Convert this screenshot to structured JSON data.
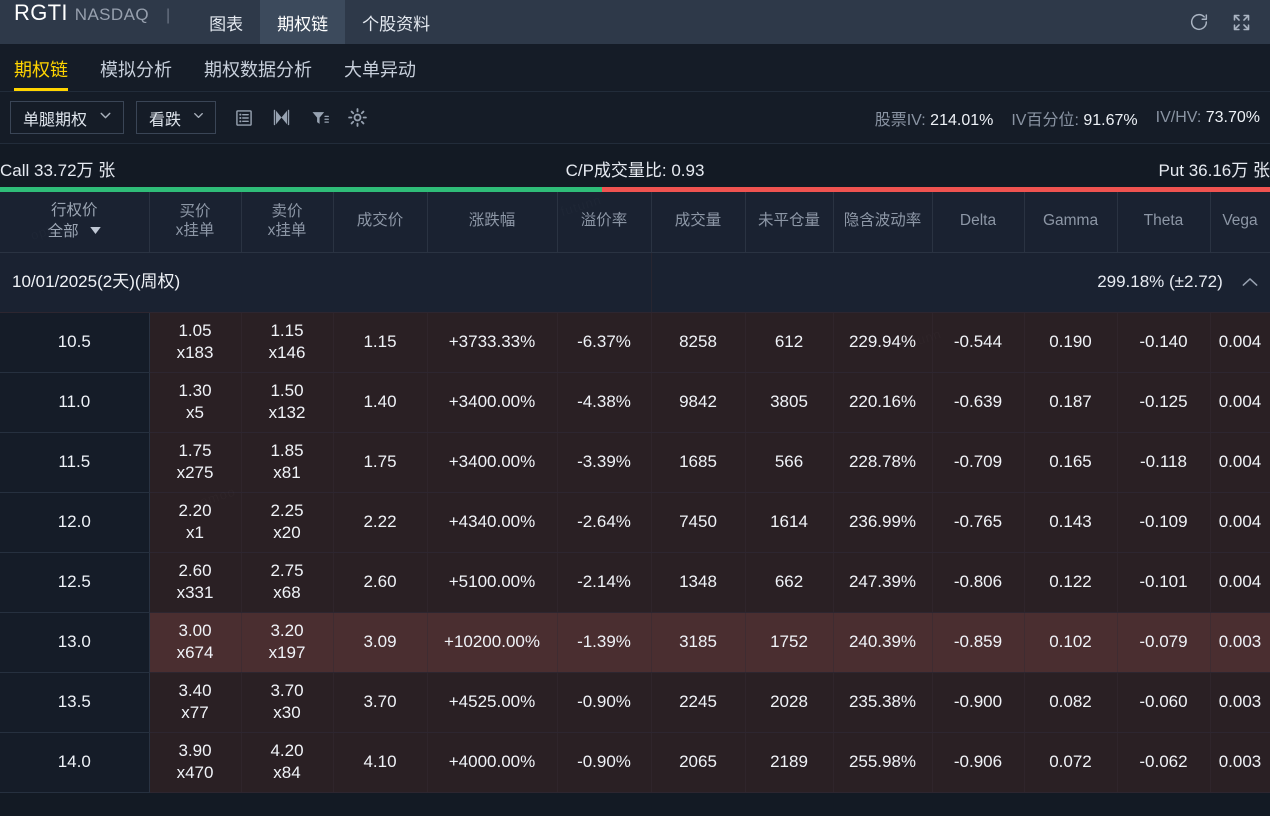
{
  "topbar": {
    "symbol": "RGTI",
    "exchange": "NASDAQ",
    "divider": "|",
    "nav": [
      {
        "label": "图表",
        "active": false
      },
      {
        "label": "期权链",
        "active": true
      },
      {
        "label": "个股资料",
        "active": false
      }
    ],
    "refresh_icon": "refresh-icon",
    "fullscreen_icon": "fullscreen-icon"
  },
  "subnav": [
    {
      "label": "期权链",
      "active": true
    },
    {
      "label": "模拟分析",
      "active": false
    },
    {
      "label": "期权数据分析",
      "active": false
    },
    {
      "label": "大单异动",
      "active": false
    }
  ],
  "toolbar": {
    "strategy_select": "单腿期权",
    "direction_select": "看跌",
    "icons": [
      "list-icon",
      "mirror-icon",
      "filter-icon",
      "gear-icon"
    ],
    "stats": [
      {
        "label": "股票IV:",
        "value": "214.01%"
      },
      {
        "label": "IV百分位:",
        "value": "91.67%"
      },
      {
        "label": "IV/HV:",
        "value": "73.70%"
      }
    ]
  },
  "volume_bar": {
    "call_label": "Call 33.72万 张",
    "ratio_label": "C/P成交量比: 0.93",
    "put_label": "Put 36.16万 张",
    "call_pct": 47.4,
    "call_color": "#2fbd78",
    "put_color": "#ef5350"
  },
  "table": {
    "columns": [
      {
        "key": "strike",
        "line1": "行权价",
        "line2": "全部",
        "has_filter": true
      },
      {
        "key": "bid",
        "line1": "买价",
        "line2": "x挂单"
      },
      {
        "key": "ask",
        "line1": "卖价",
        "line2": "x挂单"
      },
      {
        "key": "last",
        "line1": "成交价",
        "line2": ""
      },
      {
        "key": "change",
        "line1": "涨跌幅",
        "line2": ""
      },
      {
        "key": "premium",
        "line1": "溢价率",
        "line2": ""
      },
      {
        "key": "volume",
        "line1": "成交量",
        "line2": ""
      },
      {
        "key": "oi",
        "line1": "未平仓量",
        "line2": ""
      },
      {
        "key": "iv",
        "line1": "隐含波动率",
        "line2": ""
      },
      {
        "key": "delta",
        "line1": "Delta",
        "line2": ""
      },
      {
        "key": "gamma",
        "line1": "Gamma",
        "line2": ""
      },
      {
        "key": "theta",
        "line1": "Theta",
        "line2": ""
      },
      {
        "key": "vega",
        "line1": "Vega",
        "line2": ""
      }
    ],
    "expiry_group": {
      "label": "10/01/2025(2天)(周权)",
      "right_label": "299.18% (±2.72)",
      "collapse_icon": "chevron-up-icon"
    },
    "rows": [
      {
        "strike": "10.5",
        "bid": "1.05",
        "bid_sz": "x183",
        "ask": "1.15",
        "ask_sz": "x146",
        "last": "1.15",
        "change": "+3733.33%",
        "premium": "-6.37%",
        "volume": "8258",
        "oi": "612",
        "iv": "229.94%",
        "delta": "-0.544",
        "gamma": "0.190",
        "theta": "-0.140",
        "vega": "0.004",
        "highlight": false
      },
      {
        "strike": "11.0",
        "bid": "1.30",
        "bid_sz": "x5",
        "ask": "1.50",
        "ask_sz": "x132",
        "last": "1.40",
        "change": "+3400.00%",
        "premium": "-4.38%",
        "volume": "9842",
        "oi": "3805",
        "iv": "220.16%",
        "delta": "-0.639",
        "gamma": "0.187",
        "theta": "-0.125",
        "vega": "0.004",
        "highlight": false
      },
      {
        "strike": "11.5",
        "bid": "1.75",
        "bid_sz": "x275",
        "ask": "1.85",
        "ask_sz": "x81",
        "last": "1.75",
        "change": "+3400.00%",
        "premium": "-3.39%",
        "volume": "1685",
        "oi": "566",
        "iv": "228.78%",
        "delta": "-0.709",
        "gamma": "0.165",
        "theta": "-0.118",
        "vega": "0.004",
        "highlight": false
      },
      {
        "strike": "12.0",
        "bid": "2.20",
        "bid_sz": "x1",
        "ask": "2.25",
        "ask_sz": "x20",
        "last": "2.22",
        "change": "+4340.00%",
        "premium": "-2.64%",
        "volume": "7450",
        "oi": "1614",
        "iv": "236.99%",
        "delta": "-0.765",
        "gamma": "0.143",
        "theta": "-0.109",
        "vega": "0.004",
        "highlight": false
      },
      {
        "strike": "12.5",
        "bid": "2.60",
        "bid_sz": "x331",
        "ask": "2.75",
        "ask_sz": "x68",
        "last": "2.60",
        "change": "+5100.00%",
        "premium": "-2.14%",
        "volume": "1348",
        "oi": "662",
        "iv": "247.39%",
        "delta": "-0.806",
        "gamma": "0.122",
        "theta": "-0.101",
        "vega": "0.004",
        "highlight": false
      },
      {
        "strike": "13.0",
        "bid": "3.00",
        "bid_sz": "x674",
        "ask": "3.20",
        "ask_sz": "x197",
        "last": "3.09",
        "change": "+10200.00%",
        "premium": "-1.39%",
        "volume": "3185",
        "oi": "1752",
        "iv": "240.39%",
        "delta": "-0.859",
        "gamma": "0.102",
        "theta": "-0.079",
        "vega": "0.003",
        "highlight": true
      },
      {
        "strike": "13.5",
        "bid": "3.40",
        "bid_sz": "x77",
        "ask": "3.70",
        "ask_sz": "x30",
        "last": "3.70",
        "change": "+4525.00%",
        "premium": "-0.90%",
        "volume": "2245",
        "oi": "2028",
        "iv": "235.38%",
        "delta": "-0.900",
        "gamma": "0.082",
        "theta": "-0.060",
        "vega": "0.003",
        "highlight": false
      },
      {
        "strike": "14.0",
        "bid": "3.90",
        "bid_sz": "x470",
        "ask": "4.20",
        "ask_sz": "x84",
        "last": "4.10",
        "change": "+4000.00%",
        "premium": "-0.90%",
        "volume": "2065",
        "oi": "2189",
        "iv": "255.98%",
        "delta": "-0.906",
        "gamma": "0.072",
        "theta": "-0.062",
        "vega": "0.003",
        "highlight": false
      }
    ]
  }
}
